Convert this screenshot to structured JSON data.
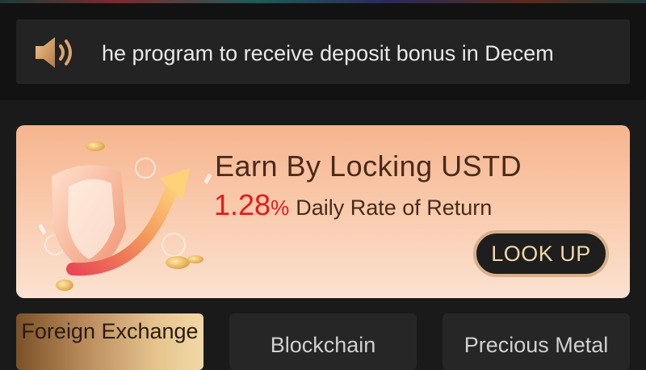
{
  "notice": {
    "icon": "speaker-icon",
    "text": "he program to receive deposit bonus in Decem"
  },
  "banner": {
    "title": "Earn By Locking USTD",
    "rate_value": "1.28",
    "rate_unit": "%",
    "rate_label": "Daily Rate of Return",
    "button_label": "LOOK UP",
    "art_icon": "shield-arrow-coins-illustration"
  },
  "tabs": [
    {
      "label": "Foreign Exchange",
      "active": true
    },
    {
      "label": "Blockchain",
      "active": false
    },
    {
      "label": "Precious Metal",
      "active": false
    }
  ],
  "colors": {
    "background": "#1a1a1a",
    "accent_gold": "#d9b08c",
    "rate_red": "#e51a1a",
    "banner_peach": "#f6b58f"
  }
}
